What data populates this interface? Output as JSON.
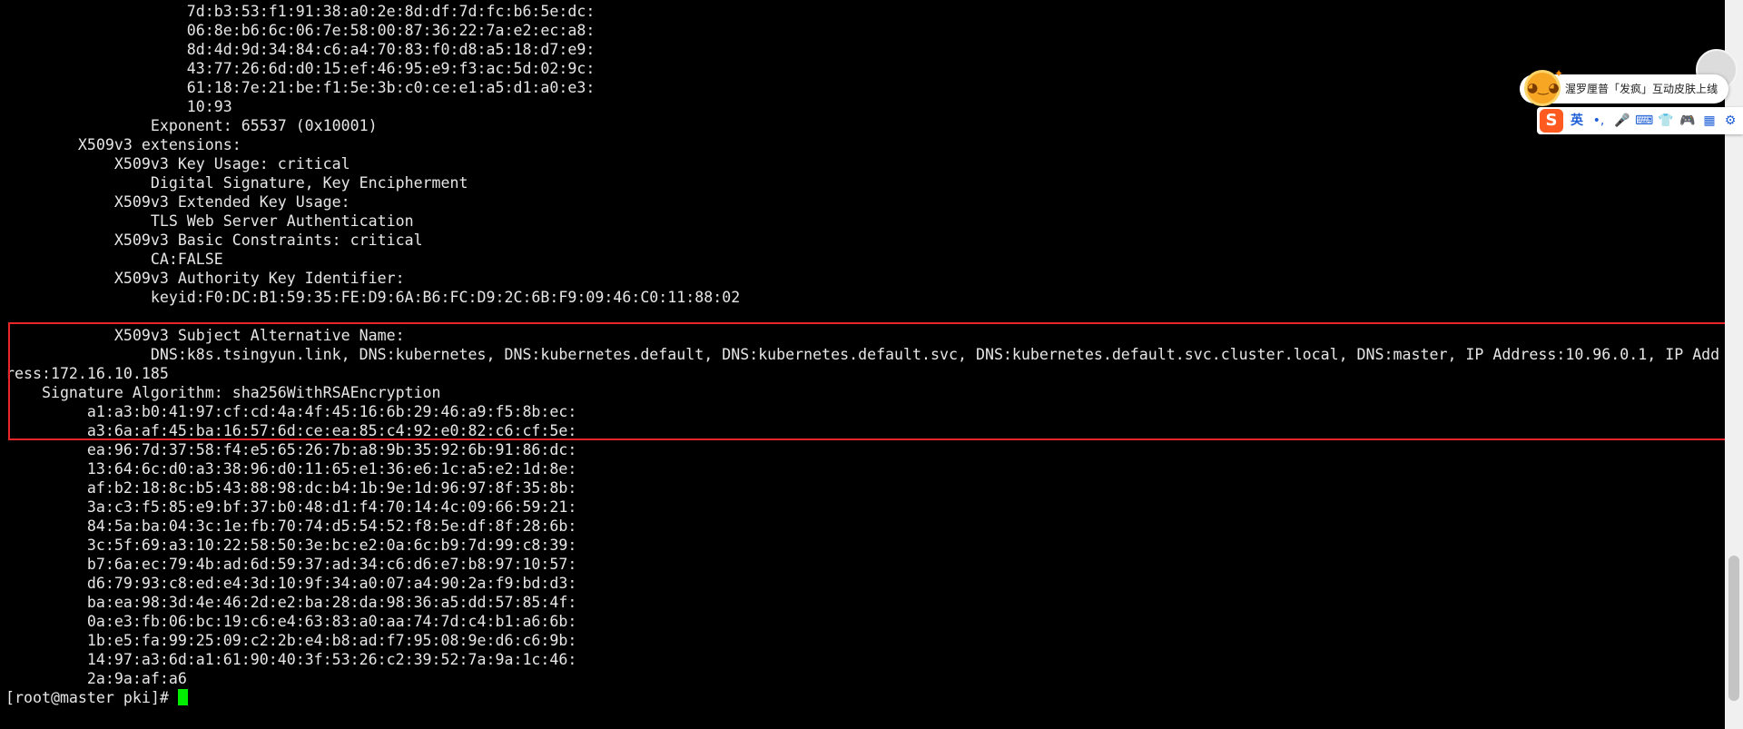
{
  "terminal": {
    "lines": [
      "                    7d:b3:53:f1:91:38:a0:2e:8d:df:7d:fc:b6:5e:dc:",
      "                    06:8e:b6:6c:06:7e:58:00:87:36:22:7a:e2:ec:a8:",
      "                    8d:4d:9d:34:84:c6:a4:70:83:f0:d8:a5:18:d7:e9:",
      "                    43:77:26:6d:d0:15:ef:46:95:e9:f3:ac:5d:02:9c:",
      "                    61:18:7e:21:be:f1:5e:3b:c0:ce:e1:a5:d1:a0:e3:",
      "                    10:93",
      "                Exponent: 65537 (0x10001)",
      "        X509v3 extensions:",
      "            X509v3 Key Usage: critical",
      "                Digital Signature, Key Encipherment",
      "            X509v3 Extended Key Usage:",
      "                TLS Web Server Authentication",
      "            X509v3 Basic Constraints: critical",
      "                CA:FALSE",
      "            X509v3 Authority Key Identifier:",
      "                keyid:F0:DC:B1:59:35:FE:D9:6A:B6:FC:D9:2C:6B:F9:09:46:C0:11:88:02",
      "",
      "            X509v3 Subject Alternative Name:",
      "                DNS:k8s.tsingyun.link, DNS:kubernetes, DNS:kubernetes.default, DNS:kubernetes.default.svc, DNS:kubernetes.default.svc.cluster.local, DNS:master, IP Address:10.96.0.1, IP Add",
      "ress:172.16.10.185",
      "    Signature Algorithm: sha256WithRSAEncryption",
      "         a1:a3:b0:41:97:cf:cd:4a:4f:45:16:6b:29:46:a9:f5:8b:ec:",
      "         a3:6a:af:45:ba:16:57:6d:ce:ea:85:c4:92:e0:82:c6:cf:5e:",
      "         ea:96:7d:37:58:f4:e5:65:26:7b:a8:9b:35:92:6b:91:86:dc:",
      "         13:64:6c:d0:a3:38:96:d0:11:65:e1:36:e6:1c:a5:e2:1d:8e:",
      "         af:b2:18:8c:b5:43:88:98:dc:b4:1b:9e:1d:96:97:8f:35:8b:",
      "         3a:c3:f5:85:e9:bf:37:b0:48:d1:f4:70:14:4c:09:66:59:21:",
      "         84:5a:ba:04:3c:1e:fb:70:74:d5:54:52:f8:5e:df:8f:28:6b:",
      "         3c:5f:69:a3:10:22:58:50:3e:bc:e2:0a:6c:b9:7d:99:c8:39:",
      "         b7:6a:ec:79:4b:ad:6d:59:37:ad:34:c6:d6:e7:b8:97:10:57:",
      "         d6:79:93:c8:ed:e4:3d:10:9f:34:a0:07:a4:90:2a:f9:bd:d3:",
      "         ba:ea:98:3d:4e:46:2d:e2:ba:28:da:98:36:a5:dd:57:85:4f:",
      "         0a:e3:fb:06:bc:19:c6:e4:63:83:a0:aa:74:7d:c4:b1:a6:6b:",
      "         1b:e5:fa:99:25:09:c2:2b:e4:b8:ad:f7:95:08:9e:d6:c6:9b:",
      "         14:97:a3:6d:a1:61:90:40:3f:53:26:c2:39:52:7a:9a:1c:46:",
      "         2a:9a:af:a6"
    ],
    "prompt": "[root@master pki]# ",
    "cursor_color": "#00ee00",
    "highlight_color": "#e8262a"
  },
  "ime": {
    "notice_text": "渥罗厘普「发疯」互动皮肤上线",
    "close_label": "×",
    "lang_label": "英",
    "logo_label": "S",
    "punct_label": "•,",
    "buttons": [
      {
        "name": "voice-icon",
        "glyph": "🎤"
      },
      {
        "name": "keyboard-icon",
        "glyph": "⌨"
      },
      {
        "name": "skin-icon",
        "glyph": "👕"
      },
      {
        "name": "game-icon",
        "glyph": "🎮"
      },
      {
        "name": "toolbox-icon",
        "glyph": "▦"
      },
      {
        "name": "settings-icon",
        "glyph": "⚙"
      }
    ]
  }
}
